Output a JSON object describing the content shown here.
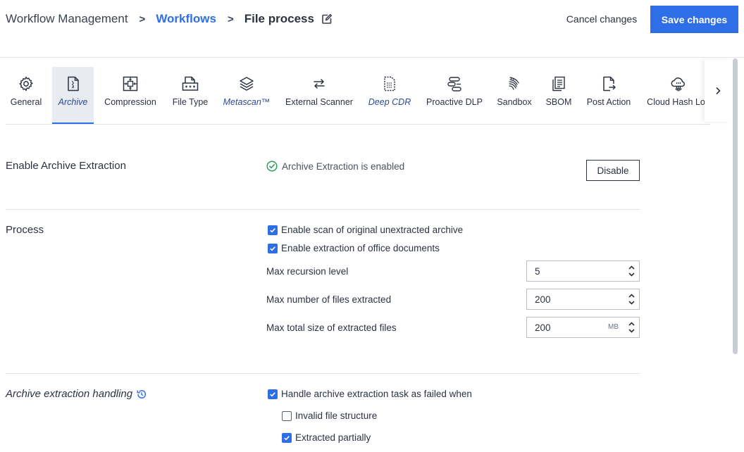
{
  "breadcrumb": {
    "root": "Workflow Management",
    "link": "Workflows",
    "current": "File process"
  },
  "header": {
    "cancel_label": "Cancel changes",
    "save_label": "Save changes"
  },
  "tabs": [
    {
      "label": "General",
      "icon": "gear-icon"
    },
    {
      "label": "Archive",
      "icon": "archive-icon",
      "active": true
    },
    {
      "label": "Compression",
      "icon": "compression-icon"
    },
    {
      "label": "File Type",
      "icon": "file-type-icon"
    },
    {
      "label": "Metascan™",
      "icon": "layers-icon"
    },
    {
      "label": "External Scanner",
      "icon": "swap-icon"
    },
    {
      "label": "Deep CDR",
      "icon": "deep-cdr-icon"
    },
    {
      "label": "Proactive DLP",
      "icon": "dlp-icon"
    },
    {
      "label": "Sandbox",
      "icon": "sandbox-icon"
    },
    {
      "label": "SBOM",
      "icon": "sbom-icon"
    },
    {
      "label": "Post Action",
      "icon": "post-action-icon"
    },
    {
      "label": "Cloud Hash Loo",
      "icon": "cloud-hash-icon"
    }
  ],
  "enable_section": {
    "title": "Enable Archive Extraction",
    "status": "Archive Extraction is enabled",
    "disable_label": "Disable"
  },
  "process": {
    "title": "Process",
    "checkboxes": [
      {
        "label": "Enable scan of original unextracted archive",
        "checked": true
      },
      {
        "label": "Enable extraction of office documents",
        "checked": true
      }
    ],
    "fields": [
      {
        "label": "Max recursion level",
        "value": "5",
        "unit": ""
      },
      {
        "label": "Max number of files extracted",
        "value": "200",
        "unit": ""
      },
      {
        "label": "Max total size of extracted files",
        "value": "200",
        "unit": "MB"
      }
    ]
  },
  "handling": {
    "title": "Archive extraction handling",
    "main_checkbox": {
      "label": "Handle archive extraction task as failed when",
      "checked": true
    },
    "sub_checkboxes": [
      {
        "label": "Invalid file structure",
        "checked": false
      },
      {
        "label": "Extracted partially",
        "checked": true
      }
    ]
  },
  "colors": {
    "accent": "#2e6ee6",
    "text": "#2b3240",
    "success": "#2e9e5b"
  }
}
